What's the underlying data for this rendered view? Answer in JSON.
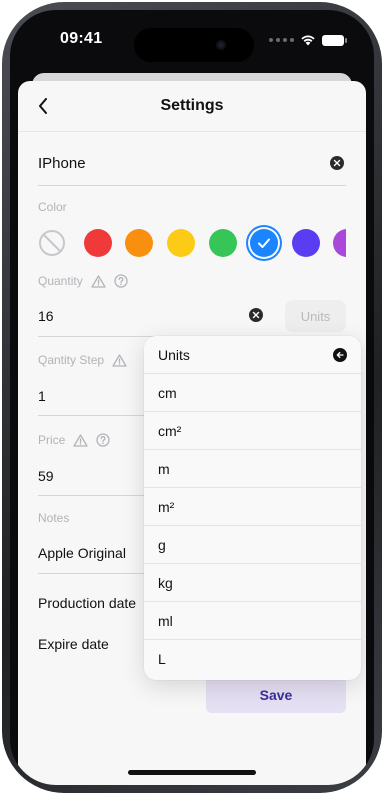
{
  "status_bar": {
    "time": "09:41"
  },
  "header": {
    "title": "Settings"
  },
  "name_field": {
    "value": "IPhone"
  },
  "color_section": {
    "label": "Color",
    "swatches": [
      {
        "name": "none",
        "color": "none"
      },
      {
        "name": "red",
        "color": "#f03a3a"
      },
      {
        "name": "orange",
        "color": "#f98f0e"
      },
      {
        "name": "yellow",
        "color": "#fccb15"
      },
      {
        "name": "green",
        "color": "#35c657"
      },
      {
        "name": "blue",
        "color": "#1b84ff",
        "selected": true
      },
      {
        "name": "indigo",
        "color": "#5a3df2"
      },
      {
        "name": "purple",
        "color": "#a948d9"
      }
    ]
  },
  "quantity": {
    "label": "Quantity",
    "value": "16",
    "units_button": "Units"
  },
  "quantity_step": {
    "label": "Qantity Step",
    "value": "1"
  },
  "price": {
    "label": "Price",
    "value": "59"
  },
  "notes": {
    "label": "Notes",
    "value": "Apple Original"
  },
  "production_date": {
    "label": "Production date"
  },
  "expire_date": {
    "label": "Expire date"
  },
  "save_button": {
    "label": "Save"
  },
  "units_menu": {
    "title": "Units",
    "options": [
      "cm",
      "cm²",
      "m",
      "m²",
      "g",
      "kg",
      "ml",
      "L"
    ]
  }
}
